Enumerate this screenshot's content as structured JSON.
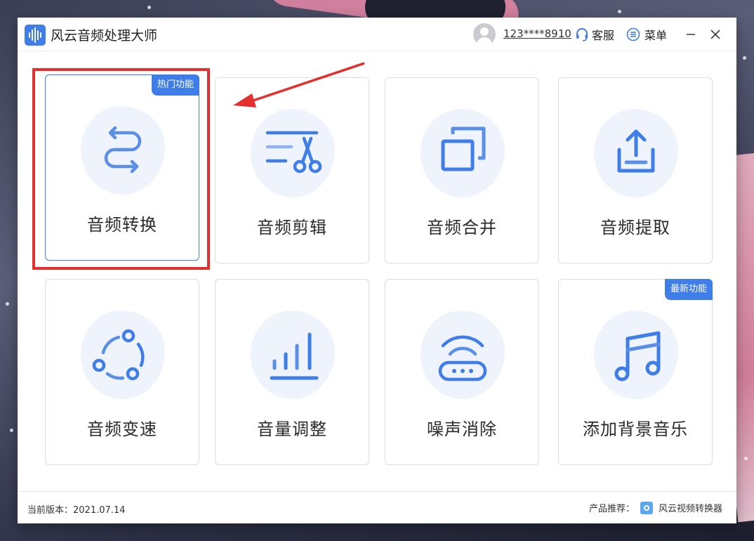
{
  "window": {
    "title": "风云音频处理大师",
    "user_phone": "123****8910",
    "service_label": "客服",
    "menu_label": "菜单"
  },
  "cards": [
    {
      "label": "音频转换",
      "badge": "热门功能",
      "icon": "convert-arrows-icon"
    },
    {
      "label": "音频剪辑",
      "badge": "",
      "icon": "scissors-icon"
    },
    {
      "label": "音频合并",
      "badge": "",
      "icon": "merge-squares-icon"
    },
    {
      "label": "音频提取",
      "badge": "",
      "icon": "upload-tray-icon"
    },
    {
      "label": "音频变速",
      "badge": "",
      "icon": "speed-orbit-icon"
    },
    {
      "label": "音量调整",
      "badge": "",
      "icon": "volume-bars-icon"
    },
    {
      "label": "噪声消除",
      "badge": "",
      "icon": "noise-router-icon"
    },
    {
      "label": "添加背景音乐",
      "badge": "最新功能",
      "icon": "music-note-icon"
    }
  ],
  "footer": {
    "version_label": "当前版本：",
    "version_value": "2021.07.14",
    "recommend_label": "产品推荐：",
    "recommend_product": "风云视频转换器"
  },
  "colors": {
    "accent": "#3f7de8",
    "icon_blob": "#eef3fc",
    "annotation_red": "#e3302f"
  }
}
